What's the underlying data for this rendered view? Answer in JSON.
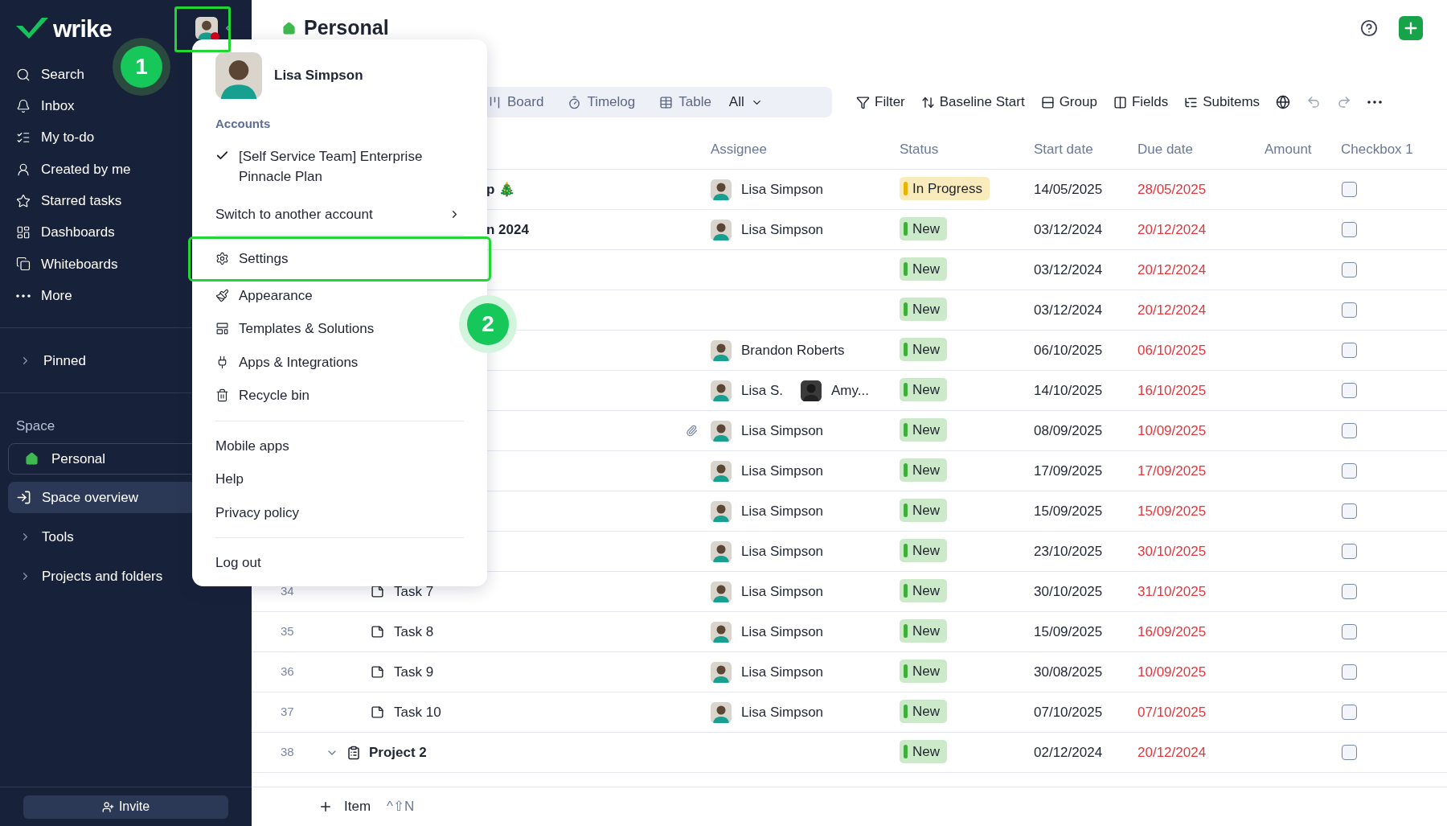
{
  "logo": {
    "text": "wrike"
  },
  "sidebar": {
    "nav": [
      {
        "label": "Search"
      },
      {
        "label": "Inbox"
      },
      {
        "label": "My to-do"
      },
      {
        "label": "Created by me"
      },
      {
        "label": "Starred tasks"
      },
      {
        "label": "Dashboards"
      },
      {
        "label": "Whiteboards"
      },
      {
        "label": "More"
      }
    ],
    "pinned": {
      "label": "Pinned",
      "expanded": false
    },
    "space_label": "Space",
    "space": "Personal",
    "items": [
      {
        "label": "Space overview",
        "selected": true,
        "kind": "link"
      },
      {
        "label": "Tools",
        "selected": false,
        "kind": "folder",
        "expanded": false
      },
      {
        "label": "Projects and folders",
        "selected": false,
        "kind": "folder",
        "expanded": false
      }
    ],
    "invite": "Invite"
  },
  "header": {
    "title": "Personal"
  },
  "toolbar": {
    "views": [
      {
        "label": "Board"
      },
      {
        "label": "Timelog"
      },
      {
        "label": "Table"
      }
    ],
    "view_filter": "All",
    "actions": [
      {
        "label": "Filter"
      },
      {
        "label": "Baseline Start"
      },
      {
        "label": "Group"
      },
      {
        "label": "Fields"
      },
      {
        "label": "Subitems"
      }
    ]
  },
  "table": {
    "columns": [
      "Assignee",
      "Status",
      "Start date",
      "Due date",
      "Amount",
      "Checkbox 1"
    ],
    "rows": [
      {
        "title": "p 🎄",
        "kind": "project",
        "assignees": [
          {
            "name": "Lisa Simpson"
          }
        ],
        "status": {
          "label": "In Progress",
          "color": "#e8b400"
        },
        "start": "14/05/2025",
        "due": "28/05/2025",
        "overdue": true,
        "checked": false
      },
      {
        "title": "n 2024",
        "kind": "project",
        "assignees": [
          {
            "name": "Lisa Simpson"
          }
        ],
        "status": {
          "label": "New",
          "color": "#3fae3a"
        },
        "start": "03/12/2024",
        "due": "20/12/2024",
        "overdue": true,
        "checked": false
      },
      {
        "assignees": [],
        "status": {
          "label": "New",
          "color": "#3fae3a"
        },
        "start": "03/12/2024",
        "due": "20/12/2024",
        "overdue": true,
        "checked": false
      },
      {
        "assignees": [],
        "status": {
          "label": "New",
          "color": "#3fae3a"
        },
        "start": "03/12/2024",
        "due": "20/12/2024",
        "overdue": true,
        "checked": false
      },
      {
        "assignees": [
          {
            "name": "Brandon Roberts"
          }
        ],
        "status": {
          "label": "New",
          "color": "#3fae3a"
        },
        "start": "06/10/2025",
        "due": "06/10/2025",
        "overdue": true,
        "checked": false
      },
      {
        "assignees": [
          {
            "name": "Lisa S."
          },
          {
            "name": "Amy..."
          }
        ],
        "status": {
          "label": "New",
          "color": "#3fae3a"
        },
        "start": "14/10/2025",
        "due": "16/10/2025",
        "overdue": true,
        "checked": false
      },
      {
        "attachment": true,
        "assignees": [
          {
            "name": "Lisa Simpson"
          }
        ],
        "status": {
          "label": "New",
          "color": "#3fae3a"
        },
        "start": "08/09/2025",
        "due": "10/09/2025",
        "overdue": true,
        "checked": false
      },
      {
        "assignees": [
          {
            "name": "Lisa Simpson"
          }
        ],
        "status": {
          "label": "New",
          "color": "#3fae3a"
        },
        "start": "17/09/2025",
        "due": "17/09/2025",
        "overdue": true,
        "checked": false
      },
      {
        "assignees": [
          {
            "name": "Lisa Simpson"
          }
        ],
        "status": {
          "label": "New",
          "color": "#3fae3a"
        },
        "start": "15/09/2025",
        "due": "15/09/2025",
        "overdue": true,
        "checked": false
      },
      {
        "assignees": [
          {
            "name": "Lisa Simpson"
          }
        ],
        "status": {
          "label": "New",
          "color": "#3fae3a"
        },
        "start": "23/10/2025",
        "due": "30/10/2025",
        "overdue": true,
        "checked": false
      },
      {
        "number": "34",
        "title": "Task 7",
        "kind": "task",
        "assignees": [
          {
            "name": "Lisa Simpson"
          }
        ],
        "status": {
          "label": "New",
          "color": "#3fae3a"
        },
        "start": "30/10/2025",
        "due": "31/10/2025",
        "overdue": true,
        "checked": false
      },
      {
        "number": "35",
        "title": "Task 8",
        "kind": "task",
        "assignees": [
          {
            "name": "Lisa Simpson"
          }
        ],
        "status": {
          "label": "New",
          "color": "#3fae3a"
        },
        "start": "15/09/2025",
        "due": "16/09/2025",
        "overdue": true,
        "checked": false
      },
      {
        "number": "36",
        "title": "Task 9",
        "kind": "task",
        "assignees": [
          {
            "name": "Lisa Simpson"
          }
        ],
        "status": {
          "label": "New",
          "color": "#3fae3a"
        },
        "start": "30/08/2025",
        "due": "10/09/2025",
        "overdue": true,
        "checked": false
      },
      {
        "number": "37",
        "title": "Task 10",
        "kind": "task",
        "assignees": [
          {
            "name": "Lisa Simpson"
          }
        ],
        "status": {
          "label": "New",
          "color": "#3fae3a"
        },
        "start": "07/10/2025",
        "due": "07/10/2025",
        "overdue": true,
        "checked": false
      },
      {
        "number": "38",
        "title": "Project 2",
        "kind": "project",
        "expanded": true,
        "assignees": [],
        "status": {
          "label": "New",
          "color": "#3fae3a"
        },
        "start": "02/12/2024",
        "due": "20/12/2024",
        "overdue": true,
        "checked": false
      }
    ]
  },
  "footer": {
    "add_label": "Item",
    "shortcut": "^⇧N"
  },
  "account_menu": {
    "name": "Lisa Simpson",
    "accounts_label": "Accounts",
    "accounts": [
      {
        "label": "[Self Service Team] Enterprise Pinnacle Plan",
        "selected": true
      }
    ],
    "switch": "Switch to another account",
    "groups": [
      [
        {
          "label": "Settings",
          "highlighted": true
        },
        {
          "label": "Appearance",
          "highlighted": false
        },
        {
          "label": "Templates & Solutions",
          "highlighted": false
        },
        {
          "label": "Apps & Integrations",
          "highlighted": false
        },
        {
          "label": "Recycle bin",
          "highlighted": false
        }
      ],
      [
        {
          "label": "Mobile apps",
          "highlighted": false
        },
        {
          "label": "Help",
          "highlighted": false
        },
        {
          "label": "Privacy policy",
          "highlighted": false
        }
      ],
      [
        {
          "label": "Log out",
          "highlighted": false
        }
      ]
    ]
  },
  "annotations": [
    {
      "label": "1"
    },
    {
      "label": "2"
    }
  ]
}
